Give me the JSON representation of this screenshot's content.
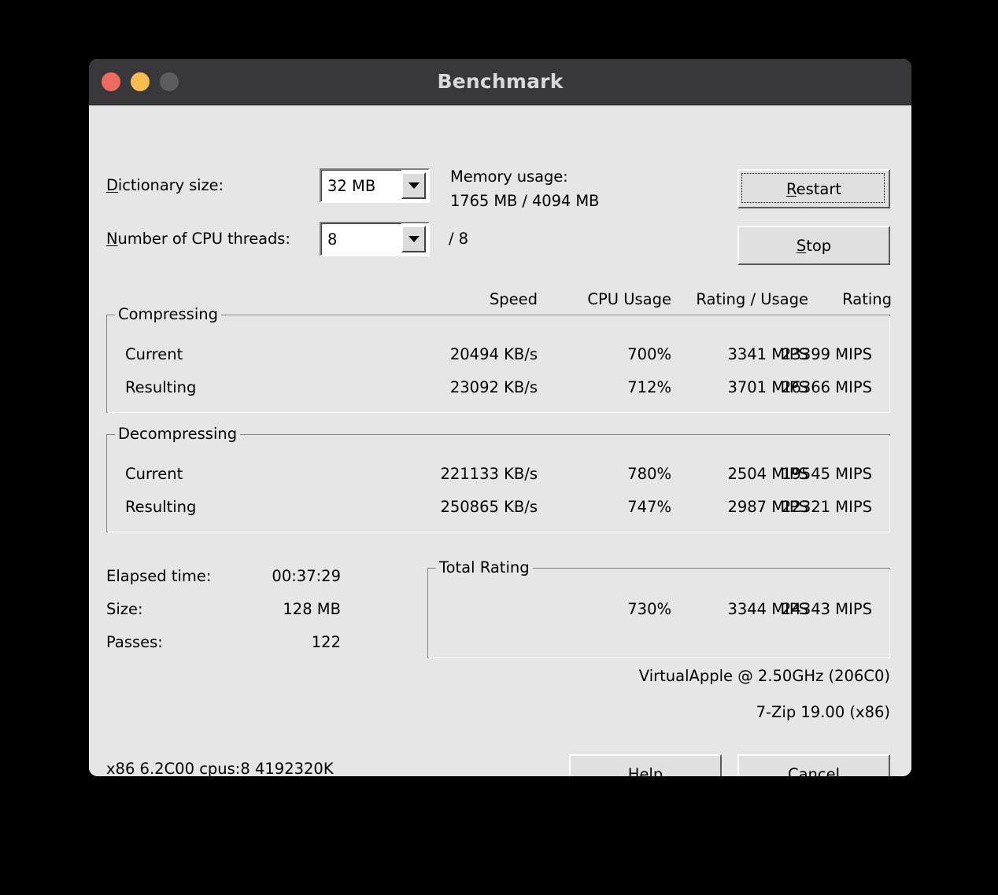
{
  "window": {
    "title": "Benchmark",
    "traffic_lights": [
      {
        "name": "close-button",
        "color": "#ec6a5e"
      },
      {
        "name": "minimize-button",
        "color": "#f5bd4f"
      },
      {
        "name": "zoom-button",
        "color": "#5c5c5e"
      }
    ]
  },
  "settings": {
    "dictionary_label": "Dictionary size:",
    "dictionary_label_mnemonic": "D",
    "dictionary_value": "32 MB",
    "threads_label": "Number of CPU threads:",
    "threads_label_mnemonic": "N",
    "threads_value": "8",
    "threads_total": "/ 8",
    "memory_label": "Memory usage:",
    "memory_value": "1765 MB / 4094 MB"
  },
  "actions": {
    "restart_label": "Restart",
    "restart_mnemonic": "R",
    "stop_label": "Stop",
    "stop_mnemonic": "S",
    "help_label": "Help",
    "help_mnemonic": "H",
    "cancel_label": "Cancel"
  },
  "columns": {
    "speed": "Speed",
    "cpu_usage": "CPU Usage",
    "rating_usage": "Rating / Usage",
    "rating": "Rating"
  },
  "compressing": {
    "title": "Compressing",
    "rows": [
      {
        "label": "Current",
        "speed": "20494 KB/s",
        "cpu_usage": "700%",
        "rating_usage": "3341 MIPS",
        "rating": "23399 MIPS"
      },
      {
        "label": "Resulting",
        "speed": "23092 KB/s",
        "cpu_usage": "712%",
        "rating_usage": "3701 MIPS",
        "rating": "26366 MIPS"
      }
    ]
  },
  "decompressing": {
    "title": "Decompressing",
    "rows": [
      {
        "label": "Current",
        "speed": "221133 KB/s",
        "cpu_usage": "780%",
        "rating_usage": "2504 MIPS",
        "rating": "19545 MIPS"
      },
      {
        "label": "Resulting",
        "speed": "250865 KB/s",
        "cpu_usage": "747%",
        "rating_usage": "2987 MIPS",
        "rating": "22321 MIPS"
      }
    ]
  },
  "stats": {
    "elapsed_label": "Elapsed time:",
    "elapsed_value": "00:37:29",
    "size_label": "Size:",
    "size_value": "128 MB",
    "passes_label": "Passes:",
    "passes_value": "122"
  },
  "total_rating": {
    "title": "Total Rating",
    "cpu_usage": "730%",
    "rating_usage": "3344 MIPS",
    "rating": "24343 MIPS"
  },
  "info": {
    "cpu": "VirtualApple @ 2.50GHz (206C0)",
    "version": "7-Zip 19.00 (x86)",
    "status": "x86 6.2C00 cpus:8 4192320K"
  },
  "theme": {
    "dialog_bg": "#e6e6e6",
    "titlebar_bg": "#38383a",
    "title_fg": "#d9d9d9",
    "text": "#000000",
    "group_border": "#888888"
  }
}
